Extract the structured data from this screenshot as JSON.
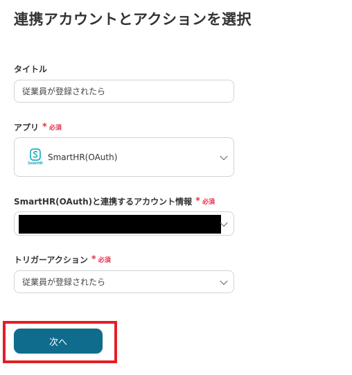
{
  "page": {
    "title": "連携アカウントとアクションを選択"
  },
  "form": {
    "title_field": {
      "label": "タイトル",
      "value": "従業員が登録されたら"
    },
    "app_field": {
      "label": "アプリ",
      "required_mark": "*",
      "required_text": "必須",
      "logo_text": "SmartHR",
      "value": "SmartHR(OAuth)"
    },
    "account_field": {
      "label": "SmartHR(OAuth)と連携するアカウント情報",
      "required_mark": "*",
      "required_text": "必須"
    },
    "trigger_field": {
      "label": "トリガーアクション",
      "required_mark": "*",
      "required_text": "必須",
      "value": "従業員が登録されたら"
    }
  },
  "actions": {
    "next_label": "次へ"
  },
  "colors": {
    "accent": "#0f6c8c",
    "required": "#e53049",
    "highlight": "#e41e26",
    "app_logo": "#00a3b4"
  }
}
